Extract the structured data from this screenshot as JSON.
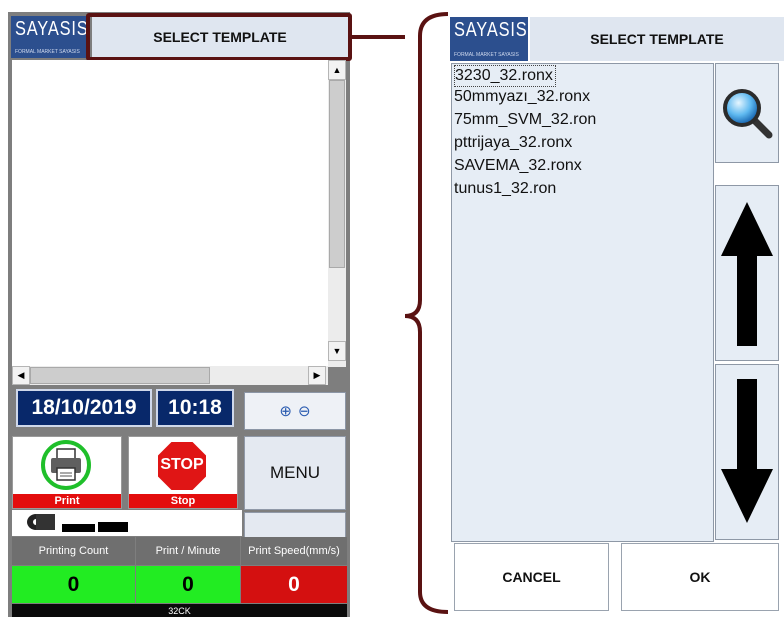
{
  "left_screen": {
    "logo_text": "SAYASIS",
    "logo_tagline": "FORMAL MARKET SAYASIS",
    "title": "SELECT TEMPLATE",
    "date": "18/10/2019",
    "time": "10:18",
    "zoom_in_glyph": "⊕",
    "zoom_out_glyph": "⊖",
    "print_button_label": "Print",
    "stop_sign_text": "STOP",
    "stop_button_label": "Stop",
    "menu_label": "MENU",
    "stats": [
      {
        "label": "Printing Count",
        "value": "0",
        "color": "#22ec22"
      },
      {
        "label": "Print / Minute",
        "value": "0",
        "color": "#22ec22"
      },
      {
        "label": "Print Speed(mm/s)",
        "value": "0",
        "color": "#d41010"
      }
    ],
    "status_text": "32CK",
    "scroll_up": "▲",
    "scroll_down": "▼",
    "scroll_left": "◀",
    "scroll_right": "▶"
  },
  "right_screen": {
    "logo_text": "SAYASIS",
    "logo_tagline": "FORMAL MARKET SAYASIS",
    "title": "SELECT TEMPLATE",
    "files": [
      "3230_32.ronx",
      "50mmyazı_32.ronx",
      "75mm_SVM_32.ron",
      "pttrijaya_32.ronx",
      "SAVEMA_32.ronx",
      "tunus1_32.ron"
    ],
    "selected_index": 0,
    "cancel_label": "CANCEL",
    "ok_label": "OK"
  },
  "icons": {
    "search": "search-icon",
    "up": "arrow-up-icon",
    "down": "arrow-down-icon",
    "printer": "printer-icon",
    "stop": "stop-sign-icon",
    "roll": "label-roll-icon"
  },
  "colors": {
    "highlight": "#5a1212",
    "logo_bg": "#2c4f8e",
    "date_bg": "#08286a",
    "title_bg": "#dfe6f0",
    "red": "#e30d0d",
    "green": "#22ec22"
  }
}
